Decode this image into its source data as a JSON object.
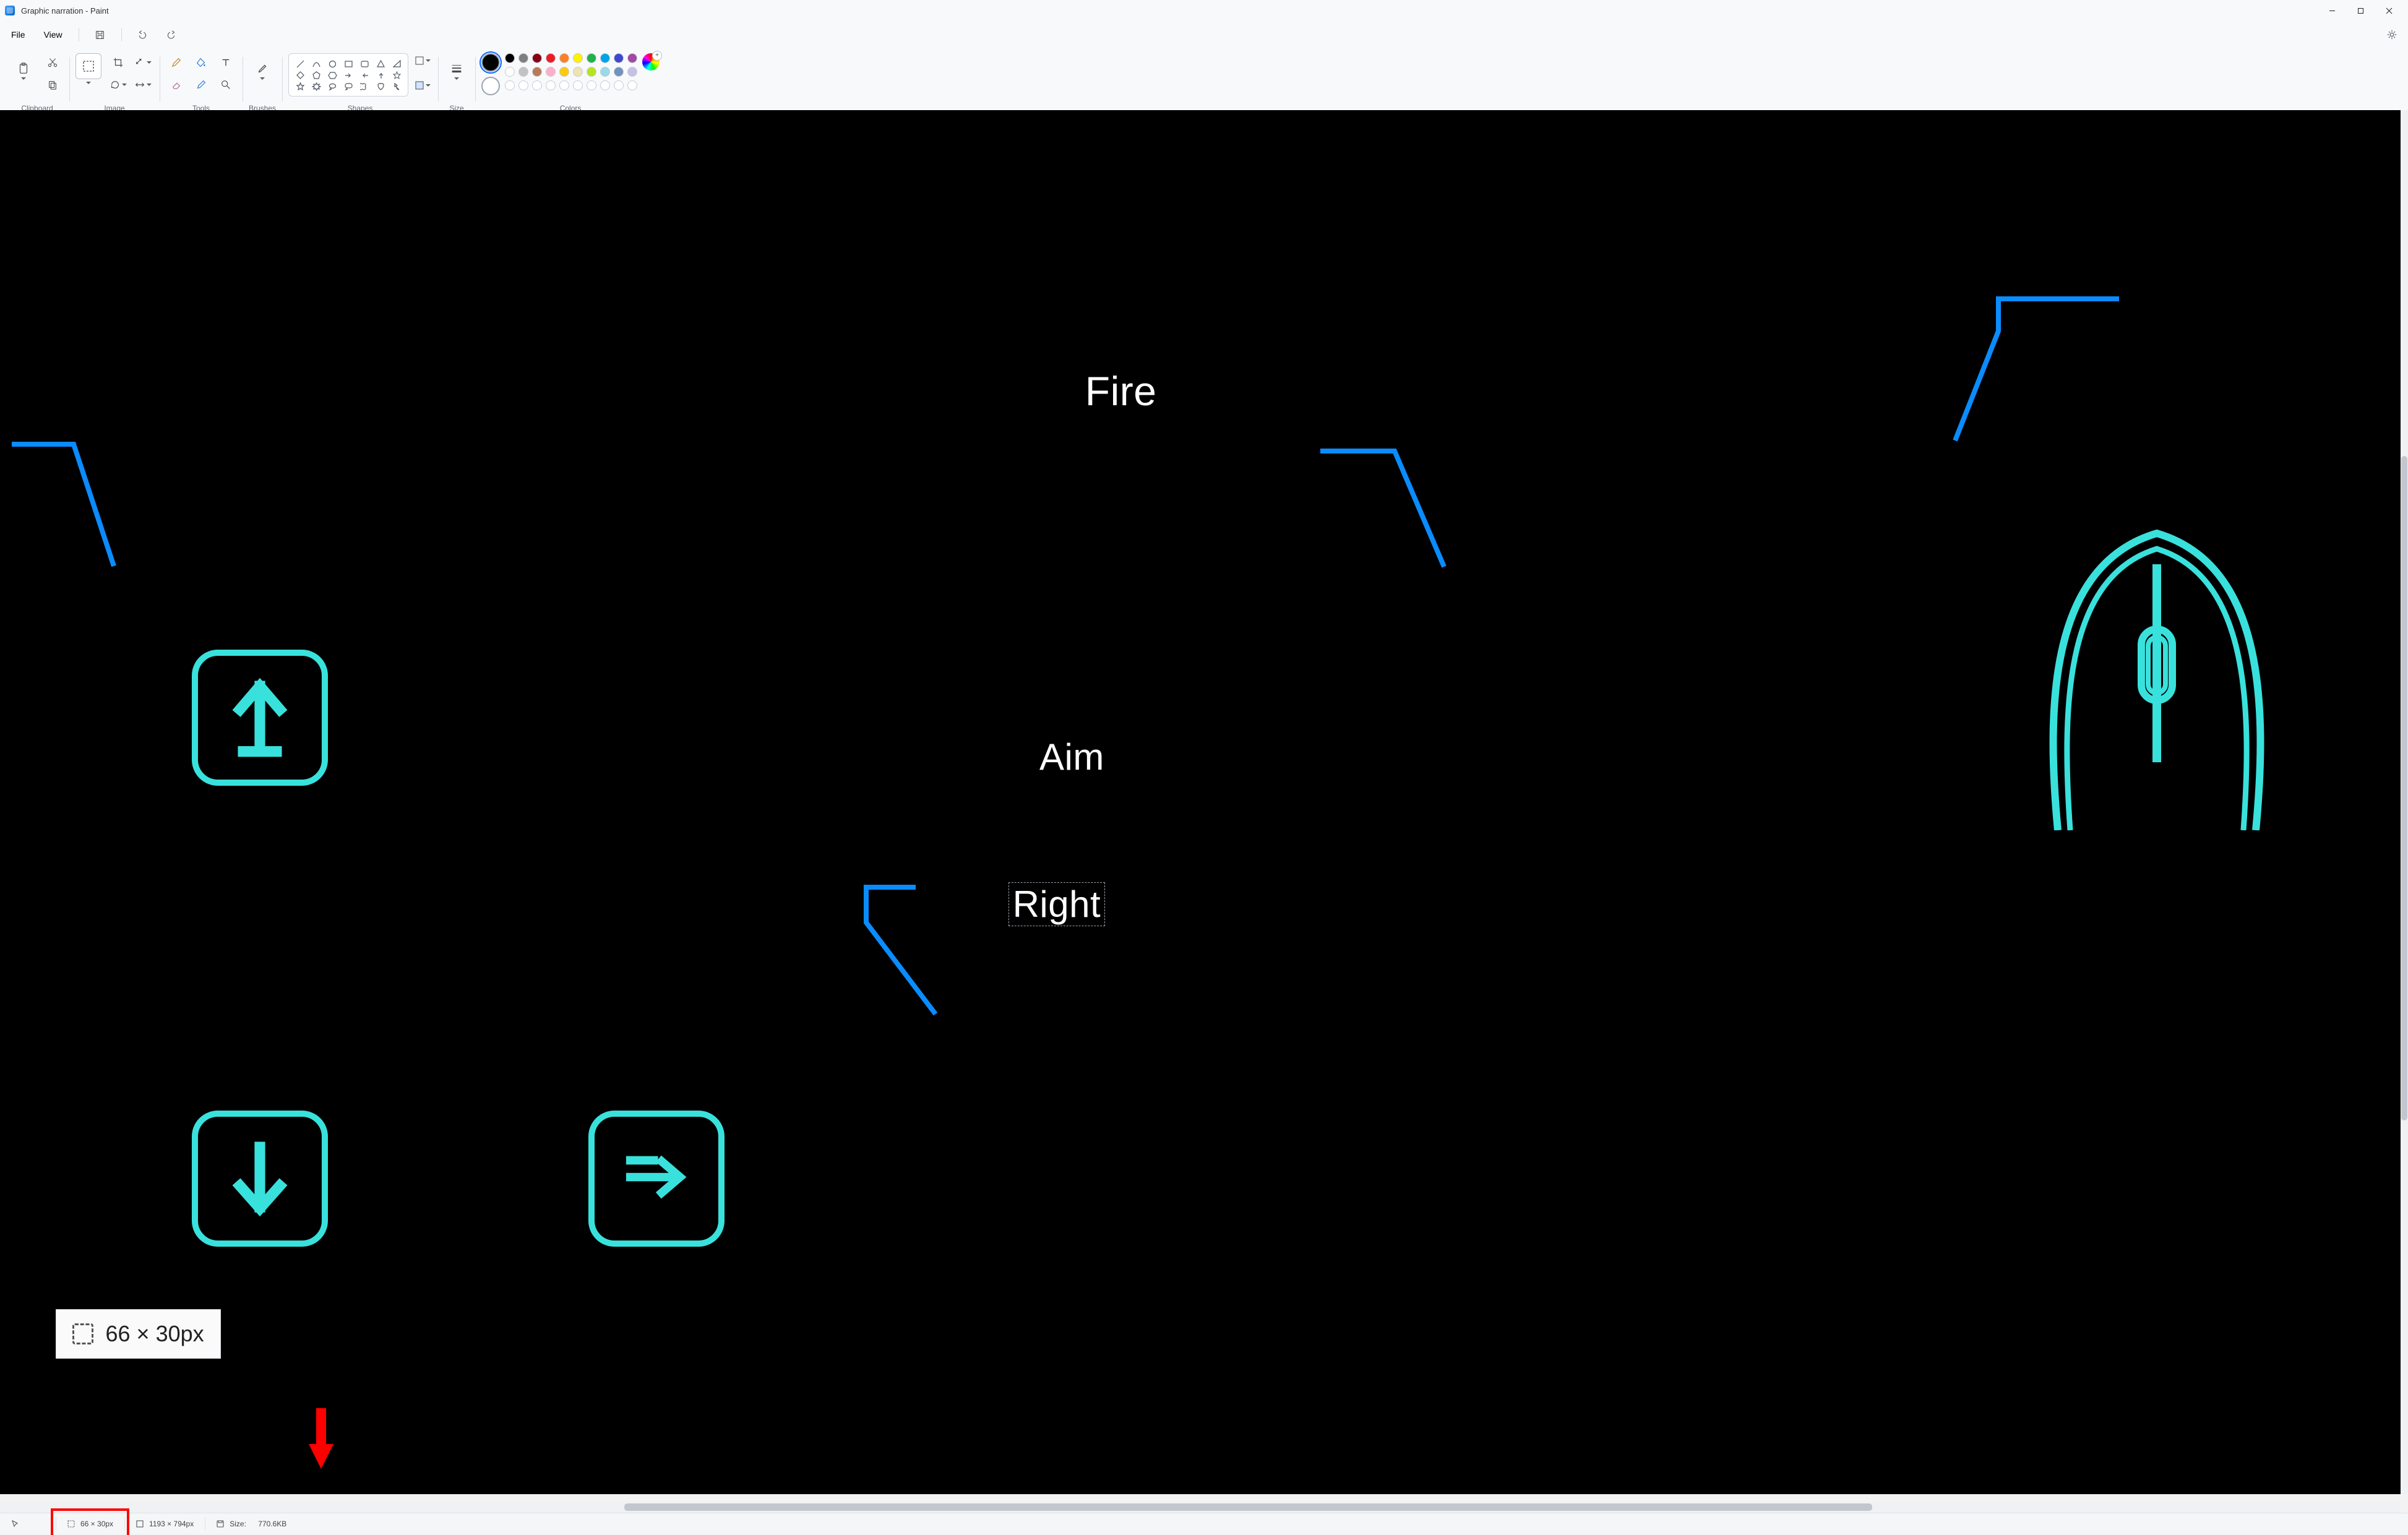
{
  "window": {
    "title": "Graphic narration - Paint"
  },
  "menu": {
    "file": "File",
    "view": "View"
  },
  "ribbon": {
    "clipboard": "Clipboard",
    "image": "Image",
    "tools": "Tools",
    "brushes": "Brushes",
    "shapes": "Shapes",
    "size": "Size",
    "colors": "Colors"
  },
  "palette": {
    "row1": [
      "#000000",
      "#7f7f7f",
      "#880015",
      "#ed1c24",
      "#ff7f27",
      "#fff200",
      "#22b14c",
      "#00a2e8",
      "#3f48cc",
      "#a349a4"
    ],
    "row2": [
      "#ffffff",
      "#c3c3c3",
      "#b97a57",
      "#ffaec9",
      "#ffc90e",
      "#efe4b0",
      "#b5e61d",
      "#99d9ea",
      "#7092be",
      "#c8bfe7"
    ]
  },
  "canvas": {
    "label_fire": "Fire",
    "label_aim": "Aim",
    "label_right": "Right"
  },
  "overlay": {
    "selection_dims": "66 × 30px"
  },
  "status": {
    "cursor": "",
    "selection": "66 × 30px",
    "canvas_size": "1193 × 794px",
    "file_size_label": "Size:",
    "file_size": "770.6KB"
  }
}
